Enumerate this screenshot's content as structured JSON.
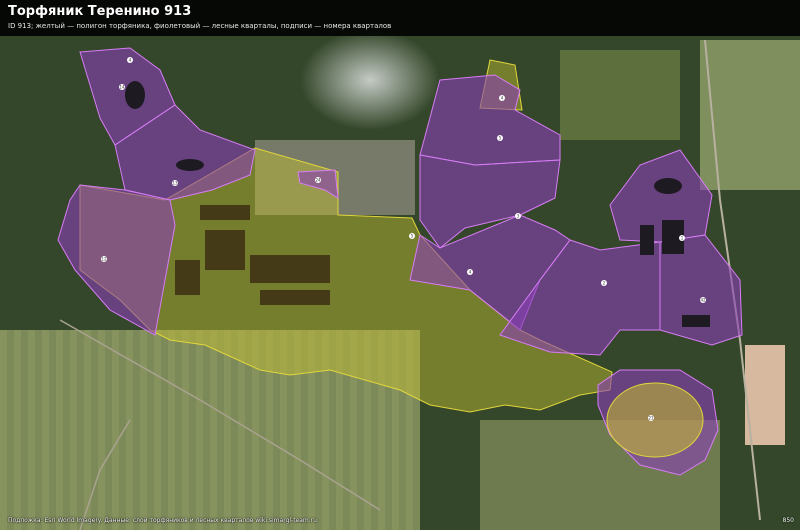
{
  "header": {
    "title": "Торфяник Теренино 913",
    "subtitle": "ID 913; желтый — полигон торфяника, фиолетовый — лесные кварталы, подписи — номера кварталов"
  },
  "footer": {
    "attribution": "Подложка: Esri World Imagery. Данные: слой торфяников и лесных кварталов wiki.simargl-team.ru",
    "corner_label": "850"
  },
  "legend_colors": {
    "peatland_polygon": "#d4c93a",
    "forest_quarters": "#9b3fc4"
  },
  "quarter_labels": [
    "4",
    "14",
    "13",
    "12",
    "24",
    "4",
    "5",
    "3",
    "4",
    "2",
    "1",
    "42",
    "21",
    "5"
  ]
}
